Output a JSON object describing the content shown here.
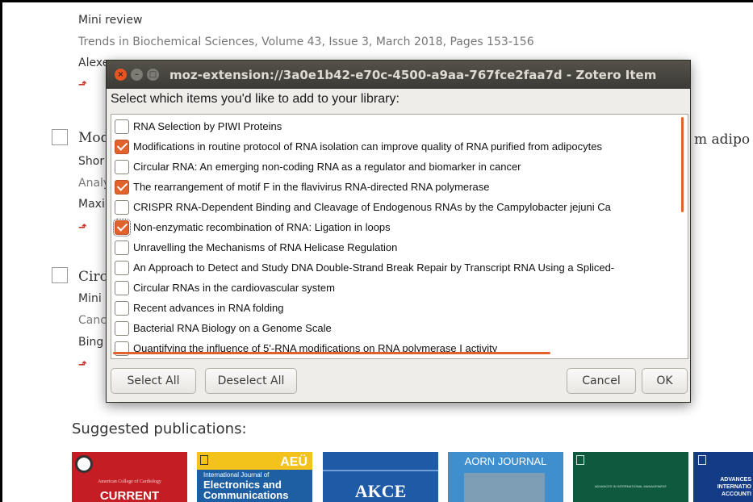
{
  "background_page": {
    "item1": {
      "type_label": "Mini review",
      "journal_line": "Trends in Biochemical Sciences, Volume 43, Issue 3, March 2018, Pages 153-156",
      "author_partial": "Alexe"
    },
    "item2": {
      "title_partial": "Mod",
      "title_tail": "m adipo",
      "type_partial": "Shor",
      "journal_partial": "Analy",
      "author_partial": "Maxi"
    },
    "item3": {
      "title_partial": "Circ",
      "type_partial": "Mini",
      "journal_partial": "Canc",
      "author_partial": "Bing"
    },
    "suggested_heading": "Suggested publications:",
    "covers": [
      {
        "text": "American College of Cardiology",
        "sub": "CURRENT",
        "color": "#c41e24"
      },
      {
        "text": "International Journal of",
        "sub": "Electronics and Communications",
        "badge": "AEÜ",
        "color": "#f3c21b"
      },
      {
        "text": "",
        "sub": "AKCE",
        "color": "#1f5aa6"
      },
      {
        "text": "AORN JOURNAL",
        "sub": "",
        "color": "#3f8fcf"
      },
      {
        "text": "ADVANCES IN INTERNATIONAL MANAGEMENT",
        "sub": "",
        "color": "#0f5a3e"
      },
      {
        "text": "ADVANCES INTERNATIO ACCOUNTI",
        "sub": "",
        "color": "#143b85"
      }
    ]
  },
  "dialog": {
    "title": "moz-extension://3a0e1b42-e70c-4500-a9aa-767fce2faa7d - Zotero Item",
    "prompt": "Select which items you'd like to add to your library:",
    "items": [
      {
        "label": "RNA Selection by PIWI Proteins",
        "checked": false
      },
      {
        "label": "Modifications in routine protocol of RNA isolation can improve quality of RNA purified from adipocytes",
        "checked": true
      },
      {
        "label": "Circular RNA: An emerging non-coding RNA as a regulator and biomarker in cancer",
        "checked": false
      },
      {
        "label": "The rearrangement of motif F in the flavivirus RNA-directed RNA polymerase",
        "checked": true
      },
      {
        "label": "CRISPR RNA-Dependent Binding and Cleavage of Endogenous RNAs by the Campylobacter jejuni Ca",
        "checked": false
      },
      {
        "label": "Non-enzymatic recombination of RNA: Ligation in loops",
        "checked": true
      },
      {
        "label": "Unravelling the Mechanisms of RNA Helicase Regulation",
        "checked": false
      },
      {
        "label": "An Approach to Detect and Study DNA Double-Strand Break Repair by Transcript RNA Using a Spliced-",
        "checked": false
      },
      {
        "label": "Circular RNAs in the cardiovascular system",
        "checked": false
      },
      {
        "label": "Recent advances in RNA folding",
        "checked": false
      },
      {
        "label": "Bacterial RNA Biology on a Genome Scale",
        "checked": false
      },
      {
        "label": "Quantifying the influence of 5'-RNA modifications on RNA polymerase I activity",
        "checked": false
      }
    ],
    "buttons": {
      "select_all": "Select All",
      "deselect_all": "Deselect All",
      "cancel": "Cancel",
      "ok": "OK"
    }
  },
  "colors": {
    "accent": "#e2622e",
    "titlebar": "#3c3b37",
    "dialog_bg": "#efedea"
  }
}
